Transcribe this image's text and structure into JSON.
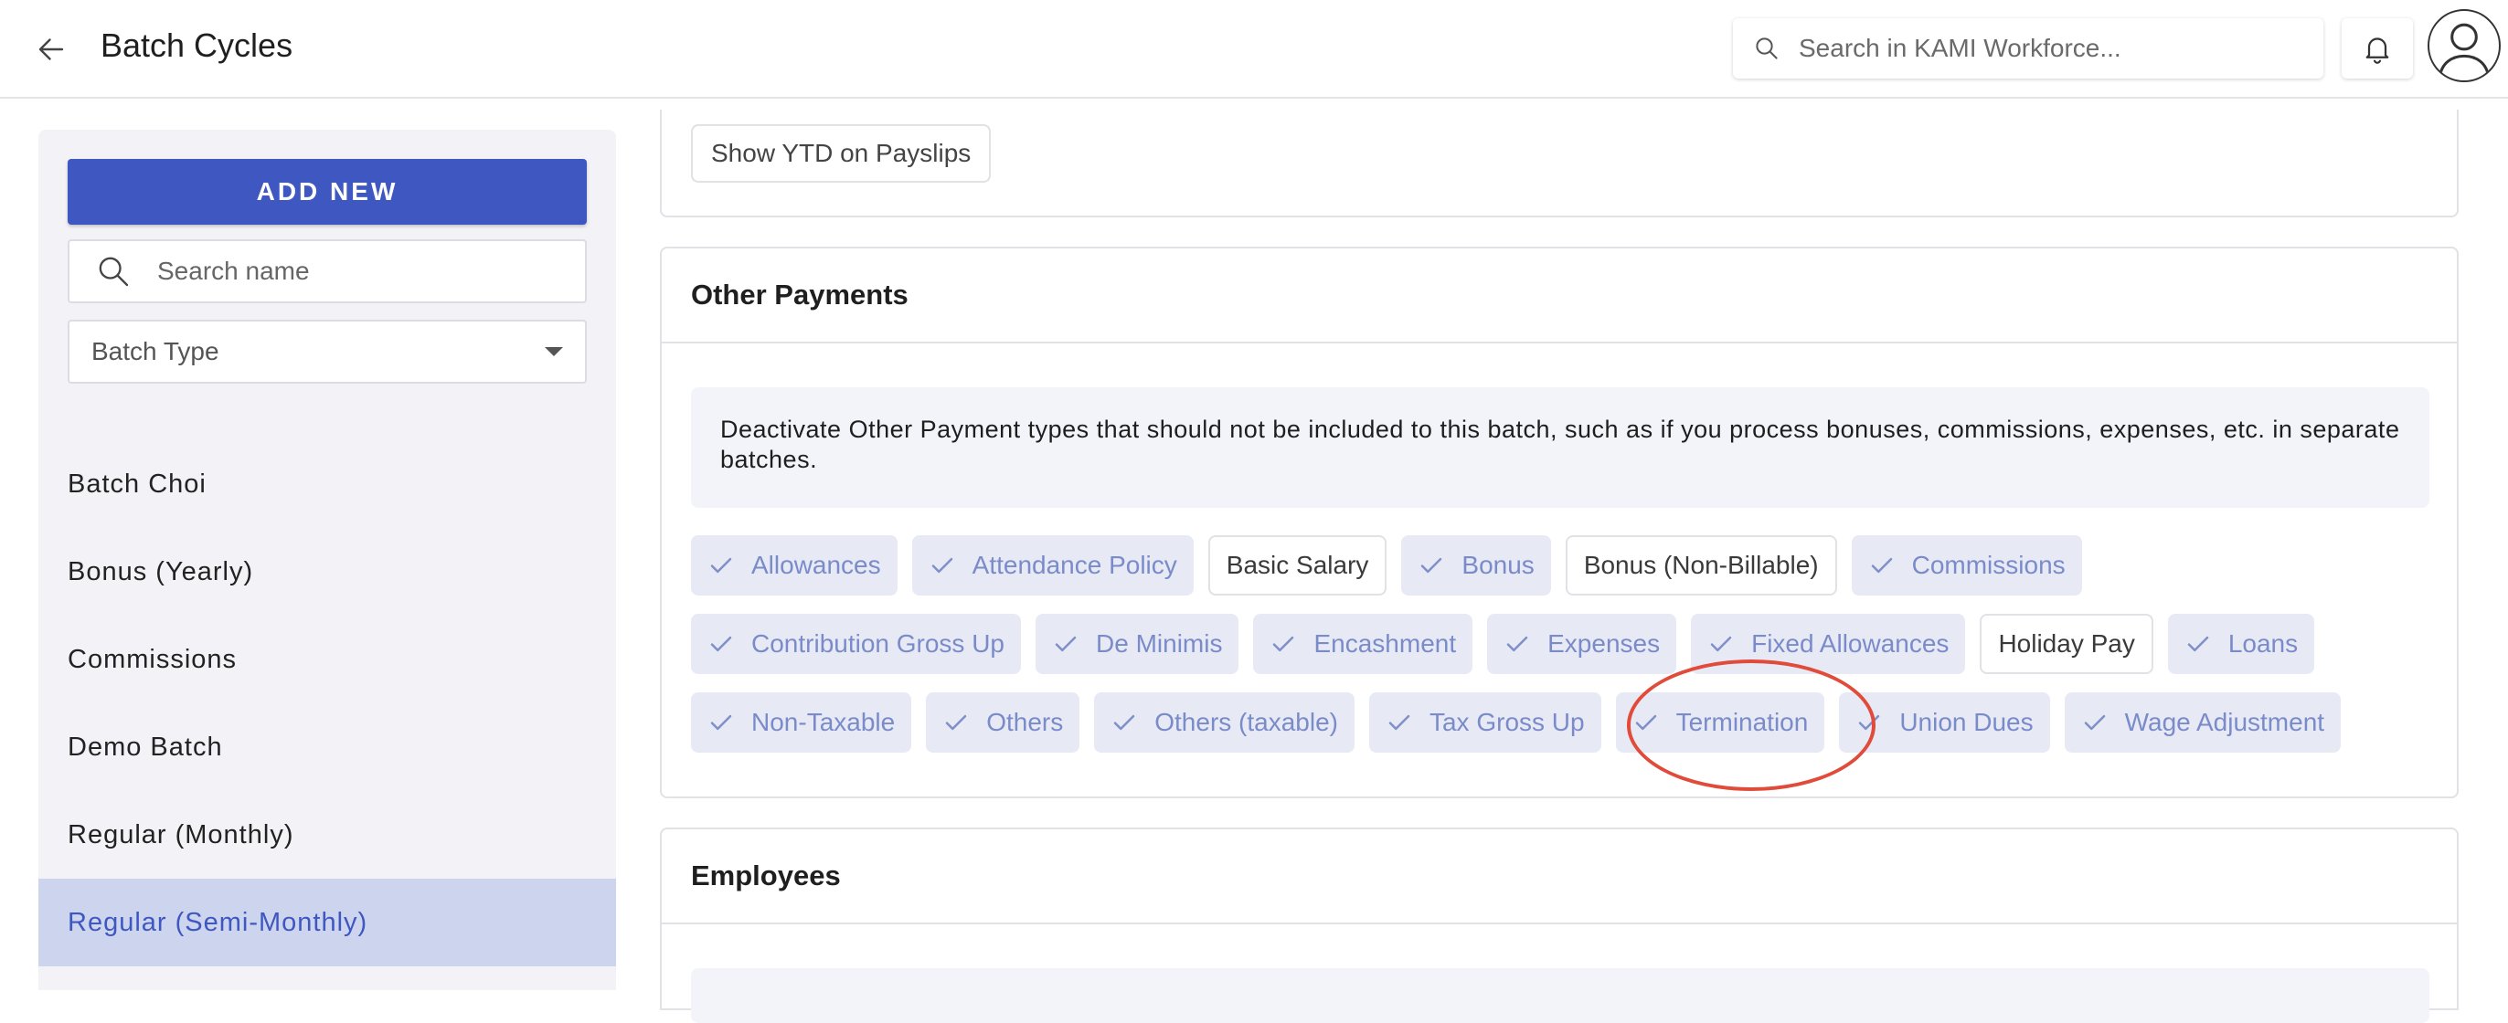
{
  "header": {
    "title": "Batch Cycles",
    "search_placeholder": "Search in KAMI Workforce...",
    "icons": [
      "back-arrow-icon",
      "search-icon",
      "bell-icon",
      "user-avatar-icon"
    ]
  },
  "sidebar": {
    "add_new_label": "ADD NEW",
    "search_placeholder": "Search name",
    "batch_type_label": "Batch Type",
    "items": [
      {
        "label": "Batch Choi",
        "active": false
      },
      {
        "label": "Bonus (Yearly)",
        "active": false
      },
      {
        "label": "Commissions",
        "active": false
      },
      {
        "label": "Demo Batch",
        "active": false
      },
      {
        "label": "Regular (Monthly)",
        "active": false
      },
      {
        "label": "Regular (Semi-Monthly)",
        "active": true
      }
    ]
  },
  "top_section": {
    "ytd_label": "Show YTD on Payslips"
  },
  "other_payments": {
    "title": "Other Payments",
    "description": "Deactivate Other Payment types that should not be included to this batch, such as if you process bonuses, commissions, expenses, etc. in separate batches.",
    "rows": [
      [
        {
          "label": "Allowances",
          "checked": true
        },
        {
          "label": "Attendance Policy",
          "checked": true
        },
        {
          "label": "Basic Salary",
          "checked": false
        },
        {
          "label": "Bonus",
          "checked": true
        },
        {
          "label": "Bonus (Non-Billable)",
          "checked": false
        },
        {
          "label": "Commissions",
          "checked": true
        }
      ],
      [
        {
          "label": "Contribution Gross Up",
          "checked": true
        },
        {
          "label": "De Minimis",
          "checked": true
        },
        {
          "label": "Encashment",
          "checked": true
        },
        {
          "label": "Expenses",
          "checked": true
        },
        {
          "label": "Fixed Allowances",
          "checked": true
        },
        {
          "label": "Holiday Pay",
          "checked": false
        },
        {
          "label": "Loans",
          "checked": true
        }
      ],
      [
        {
          "label": "Non-Taxable",
          "checked": true
        },
        {
          "label": "Others",
          "checked": true
        },
        {
          "label": "Others (taxable)",
          "checked": true
        },
        {
          "label": "Tax Gross Up",
          "checked": true
        },
        {
          "label": "Termination",
          "checked": true
        },
        {
          "label": "Union Dues",
          "checked": true
        },
        {
          "label": "Wage Adjustment",
          "checked": true
        }
      ]
    ],
    "highlighted_item": "Termination"
  },
  "employees": {
    "title": "Employees"
  },
  "colors": {
    "primary": "#3f57c0",
    "active_item_bg": "#cdd4ee",
    "chip_on_bg": "#e7e9f4",
    "chip_on_text": "#7a8bca",
    "highlight_ring": "#e04b3a"
  }
}
